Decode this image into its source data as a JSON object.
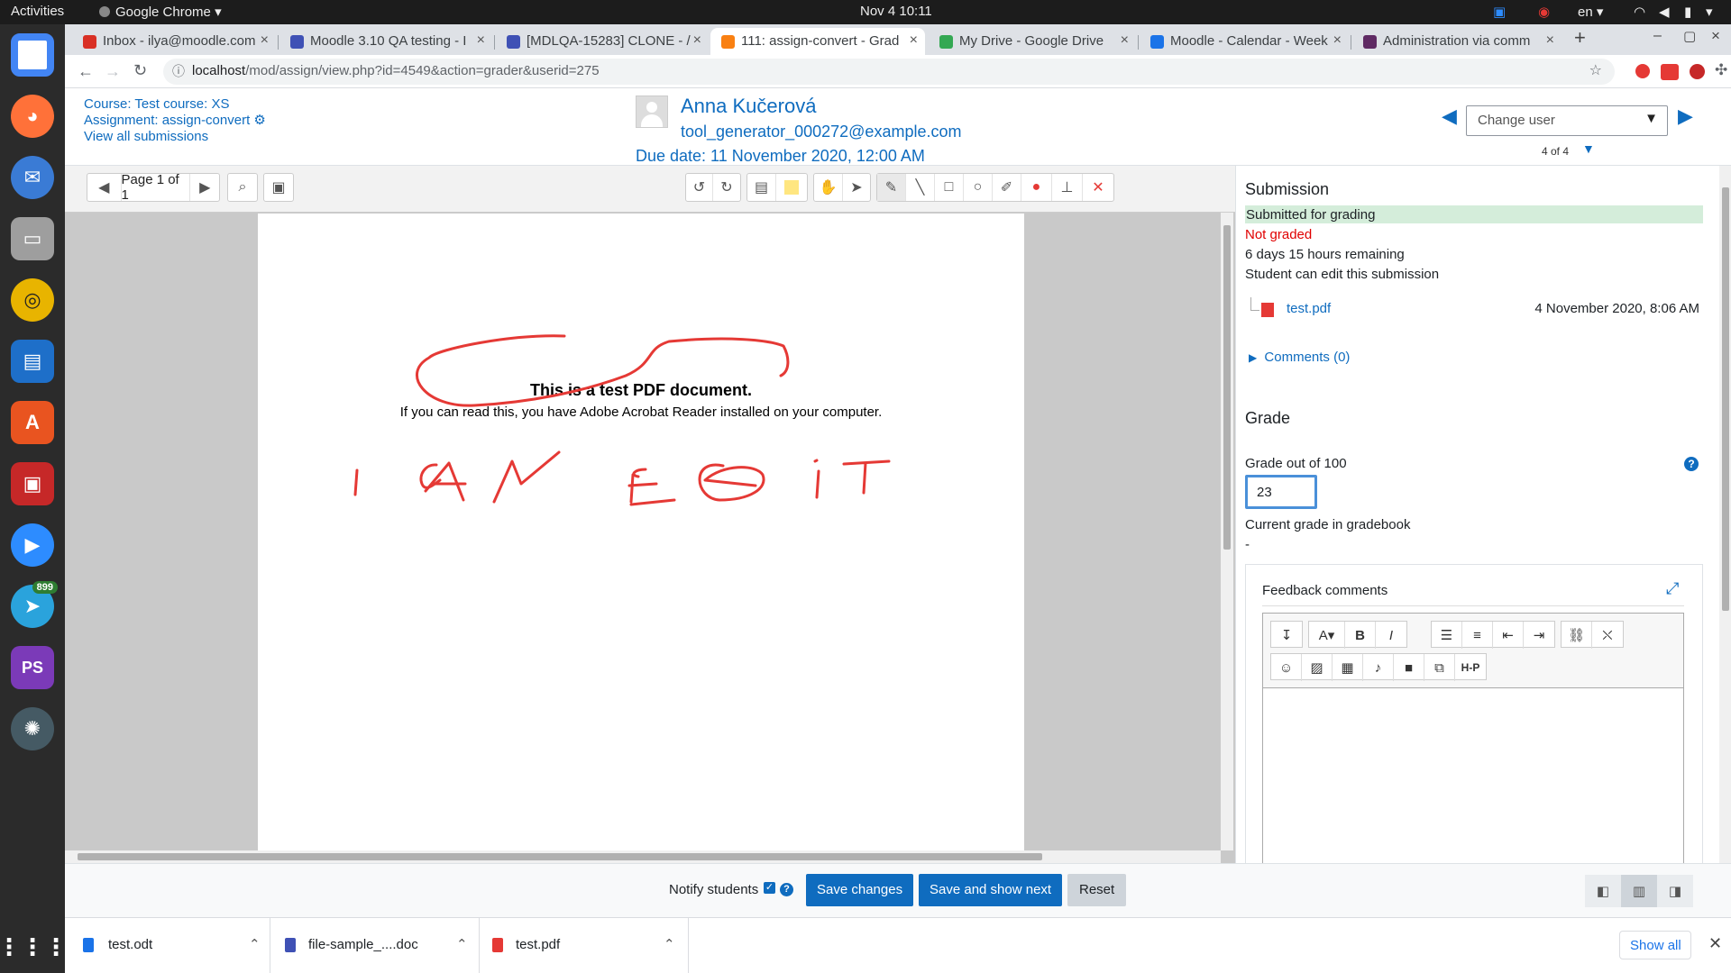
{
  "topbar": {
    "activities": "Activities",
    "app_name": "Google Chrome",
    "datetime": "Nov 4  10:11",
    "lang": "en"
  },
  "dock": {
    "apps": [
      {
        "name": "chrome-icon",
        "glyph": "◉",
        "color": "#4285f4"
      },
      {
        "name": "firefox-icon",
        "glyph": "◕",
        "color": "#ff7139"
      },
      {
        "name": "thunderbird-icon",
        "glyph": "✉",
        "color": "#3a7bd5"
      },
      {
        "name": "files-icon",
        "glyph": "▭",
        "color": "#9e9e9e"
      },
      {
        "name": "rhythmbox-icon",
        "glyph": "◎",
        "color": "#e8b400"
      },
      {
        "name": "writer-icon",
        "glyph": "▤",
        "color": "#1e6fc9"
      },
      {
        "name": "software-icon",
        "glyph": "A",
        "color": "#e95420"
      },
      {
        "name": "terminal-icon",
        "glyph": "▣",
        "color": "#c62828"
      },
      {
        "name": "zoom-icon",
        "glyph": "▶",
        "color": "#2d8cff"
      },
      {
        "name": "telegram-icon",
        "glyph": "➤",
        "color": "#2aa3dc"
      },
      {
        "name": "phpstorm-icon",
        "glyph": "PS",
        "color": "#7b3ab8"
      },
      {
        "name": "screenshot-icon",
        "glyph": "✺",
        "color": "#455a64"
      },
      {
        "name": "app-grid-icon",
        "glyph": "⋮⋮",
        "color": "#2b2b2b"
      }
    ],
    "telegram_badge": "899"
  },
  "tabs": [
    {
      "title": "Inbox - ilya@moodle.com",
      "fav": "#d93025"
    },
    {
      "title": "Moodle 3.10 QA testing - I",
      "fav": "#3f51b5"
    },
    {
      "title": "[MDLQA-15283] CLONE - /",
      "fav": "#3f51b5"
    },
    {
      "title": "111: assign-convert - Grad",
      "fav": "#f98012"
    },
    {
      "title": "My Drive - Google Drive",
      "fav": "#34a853"
    },
    {
      "title": "Moodle - Calendar - Week",
      "fav": "#1a73e8"
    },
    {
      "title": "Administration via comm",
      "fav": "#5f2a63"
    }
  ],
  "url": {
    "host": "localhost",
    "path": "/mod/assign/view.php?id=4549&action=grader&userid=275"
  },
  "header": {
    "course": "Course: Test course: XS",
    "assignment": "Assignment: assign-convert",
    "view_all": "View all submissions",
    "user_name": "Anna Kučerová",
    "user_email": "tool_generator_000272@example.com",
    "due_date": "Due date: 11 November 2020, 12:00 AM",
    "change_user_placeholder": "Change user",
    "user_count": "4 of 4"
  },
  "pdf": {
    "page_label": "Page 1 of 1",
    "doc_title": "This is a test PDF document.",
    "doc_body": "If you can read this, you have Adobe Acrobat Reader installed on your computer."
  },
  "submission": {
    "heading": "Submission",
    "status": "Submitted for grading",
    "grading_status": "Not graded",
    "time_remaining": "6 days 15 hours remaining",
    "can_edit": "Student can edit this submission",
    "file_name": "test.pdf",
    "file_date": "4 November 2020, 8:06 AM",
    "comments": "Comments (0)"
  },
  "grade": {
    "heading": "Grade",
    "label": "Grade out of 100",
    "value": "23",
    "current_label": "Current grade in gradebook",
    "current_value": "-",
    "feedback_label": "Feedback comments"
  },
  "actions": {
    "notify": "Notify students",
    "save": "Save changes",
    "save_next": "Save and show next",
    "reset": "Reset"
  },
  "downloads": {
    "items": [
      "test.odt",
      "file-sample_....doc",
      "test.pdf"
    ],
    "show_all": "Show all"
  },
  "colors": {
    "moodle_blue": "#0f6cbf",
    "submitted_bg": "#d4edda",
    "not_graded": "#e00000",
    "annotation_red": "#e53935"
  }
}
